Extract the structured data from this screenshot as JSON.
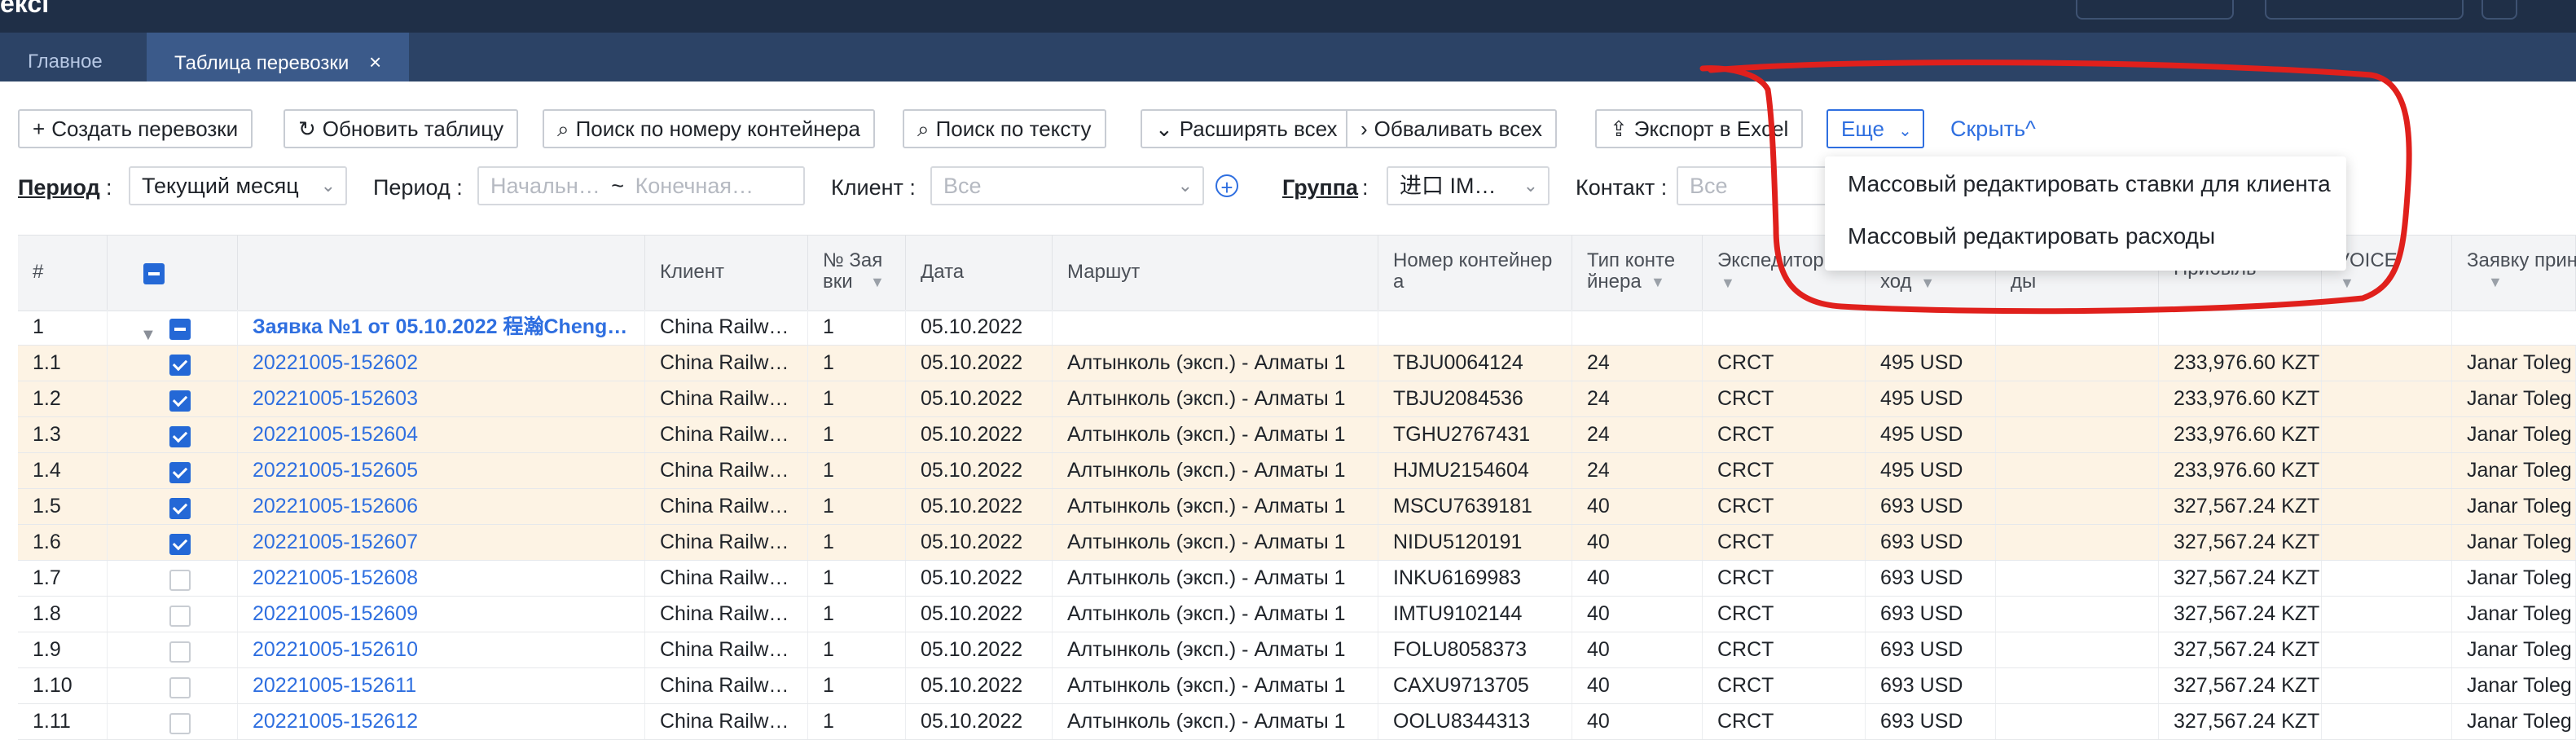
{
  "topbar": {
    "brand": "ексі"
  },
  "tabs": [
    {
      "label": "Главное"
    },
    {
      "label": "Таблица перевозки",
      "close": "×"
    }
  ],
  "toolbar": {
    "create": "Создать перевозки",
    "refresh": "Обновить таблицу",
    "search_container": "Поиск по номеру контейнера",
    "search_text": "Поиск по тексту",
    "expand_all": "Расширять всех",
    "collapse_all": "Обваливать всех",
    "export": "Экспорт в Excel",
    "more": "Еще",
    "hide": "Скрыть"
  },
  "filters": {
    "period_label": "Период",
    "period_value": "Текущий месяц",
    "period2_label": "Период",
    "date_start_placeholder": "Начальн…",
    "date_separator": "~",
    "date_end_placeholder": "Конечная…",
    "client_label": "Клиент",
    "client_value": "Все",
    "group_label": "Группа",
    "group_value": "进口 IM…",
    "contact_label": "Контакт",
    "contact_value": "Все"
  },
  "dropdown": {
    "items": [
      "Массовый редактировать ставки для клиента",
      "Массовый редактировать расходы"
    ]
  },
  "table": {
    "headers": {
      "num": "#",
      "client": "Клиент",
      "request_no": "№ Зая вки",
      "date": "Дата",
      "route": "Маршут",
      "container_no": "Номер контейнер а",
      "container_type": "Тип конте йнера",
      "forwarder": "Экспедитор",
      "expense": "ход",
      "col_dy": "ды",
      "revenue": "Прибыль",
      "invoice": "VOICE",
      "request_accepted": "Заявку прин л"
    },
    "group_row": {
      "num": "1",
      "title": "Заявка №1 от 05.10.2022 程瀚Cheng…",
      "client": "China Railw…",
      "req": "1",
      "date": "05.10.2022"
    },
    "rows": [
      {
        "num": "1.1",
        "id": "20221005-152602",
        "client": "China Railw…",
        "req": "1",
        "date": "05.10.2022",
        "route": "Алтынколь (эксп.) - Алматы 1",
        "container": "TBJU0064124",
        "type": "24",
        "fwd": "CRCT",
        "exp": "495 USD",
        "profit": "233,976.60 KZT",
        "acc": "Janar Toleg",
        "checked": true
      },
      {
        "num": "1.2",
        "id": "20221005-152603",
        "client": "China Railw…",
        "req": "1",
        "date": "05.10.2022",
        "route": "Алтынколь (эксп.) - Алматы 1",
        "container": "TBJU2084536",
        "type": "24",
        "fwd": "CRCT",
        "exp": "495 USD",
        "profit": "233,976.60 KZT",
        "acc": "Janar Toleg",
        "checked": true
      },
      {
        "num": "1.3",
        "id": "20221005-152604",
        "client": "China Railw…",
        "req": "1",
        "date": "05.10.2022",
        "route": "Алтынколь (эксп.) - Алматы 1",
        "container": "TGHU2767431",
        "type": "24",
        "fwd": "CRCT",
        "exp": "495 USD",
        "profit": "233,976.60 KZT",
        "acc": "Janar Toleg",
        "checked": true
      },
      {
        "num": "1.4",
        "id": "20221005-152605",
        "client": "China Railw…",
        "req": "1",
        "date": "05.10.2022",
        "route": "Алтынколь (эксп.) - Алматы 1",
        "container": "HJMU2154604",
        "type": "24",
        "fwd": "CRCT",
        "exp": "495 USD",
        "profit": "233,976.60 KZT",
        "acc": "Janar Toleg",
        "checked": true
      },
      {
        "num": "1.5",
        "id": "20221005-152606",
        "client": "China Railw…",
        "req": "1",
        "date": "05.10.2022",
        "route": "Алтынколь (эксп.) - Алматы 1",
        "container": "MSCU7639181",
        "type": "40",
        "fwd": "CRCT",
        "exp": "693 USD",
        "profit": "327,567.24 KZT",
        "acc": "Janar Toleg",
        "checked": true
      },
      {
        "num": "1.6",
        "id": "20221005-152607",
        "client": "China Railw…",
        "req": "1",
        "date": "05.10.2022",
        "route": "Алтынколь (эксп.) - Алматы 1",
        "container": "NIDU5120191",
        "type": "40",
        "fwd": "CRCT",
        "exp": "693 USD",
        "profit": "327,567.24 KZT",
        "acc": "Janar Toleg",
        "checked": true
      },
      {
        "num": "1.7",
        "id": "20221005-152608",
        "client": "China Railw…",
        "req": "1",
        "date": "05.10.2022",
        "route": "Алтынколь (эксп.) - Алматы 1",
        "container": "INKU6169983",
        "type": "40",
        "fwd": "CRCT",
        "exp": "693 USD",
        "profit": "327,567.24 KZT",
        "acc": "Janar Toleg",
        "checked": false
      },
      {
        "num": "1.8",
        "id": "20221005-152609",
        "client": "China Railw…",
        "req": "1",
        "date": "05.10.2022",
        "route": "Алтынколь (эксп.) - Алматы 1",
        "container": "IMTU9102144",
        "type": "40",
        "fwd": "CRCT",
        "exp": "693 USD",
        "profit": "327,567.24 KZT",
        "acc": "Janar Toleg",
        "checked": false
      },
      {
        "num": "1.9",
        "id": "20221005-152610",
        "client": "China Railw…",
        "req": "1",
        "date": "05.10.2022",
        "route": "Алтынколь (эксп.) - Алматы 1",
        "container": "FOLU8058373",
        "type": "40",
        "fwd": "CRCT",
        "exp": "693 USD",
        "profit": "327,567.24 KZT",
        "acc": "Janar Toleg",
        "checked": false
      },
      {
        "num": "1.10",
        "id": "20221005-152611",
        "client": "China Railw…",
        "req": "1",
        "date": "05.10.2022",
        "route": "Алтынколь (эксп.) - Алматы 1",
        "container": "CAXU9713705",
        "type": "40",
        "fwd": "CRCT",
        "exp": "693 USD",
        "profit": "327,567.24 KZT",
        "acc": "Janar Toleg",
        "checked": false
      },
      {
        "num": "1.11",
        "id": "20221005-152612",
        "client": "China Railw…",
        "req": "1",
        "date": "05.10.2022",
        "route": "Алтынколь (эксп.) - Алматы 1",
        "container": "OOLU8344313",
        "type": "40",
        "fwd": "CRCT",
        "exp": "693 USD",
        "profit": "327,567.24 KZT",
        "acc": "Janar Toleg",
        "checked": false
      }
    ]
  },
  "colors": {
    "accent": "#2f6fe0",
    "selected_row": "#fdf3e4",
    "annotation": "#e0201c",
    "topbar": "#1f2f47",
    "tabbar": "#2c4366"
  }
}
